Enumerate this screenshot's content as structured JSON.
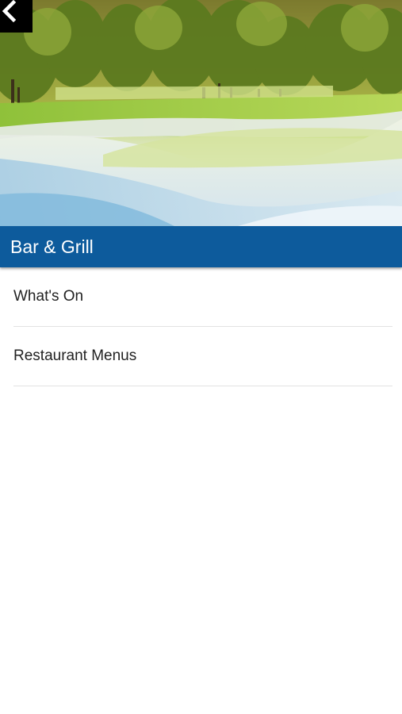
{
  "header": {
    "back_icon": "chevron-left-icon",
    "title": "Bar & Grill"
  },
  "menu": {
    "items": [
      {
        "label": "What's On"
      },
      {
        "label": "Restaurant Menus"
      }
    ]
  },
  "colors": {
    "title_bar": "#0d5b9c",
    "back_button": "#000000",
    "divider": "#e3e3e3"
  }
}
